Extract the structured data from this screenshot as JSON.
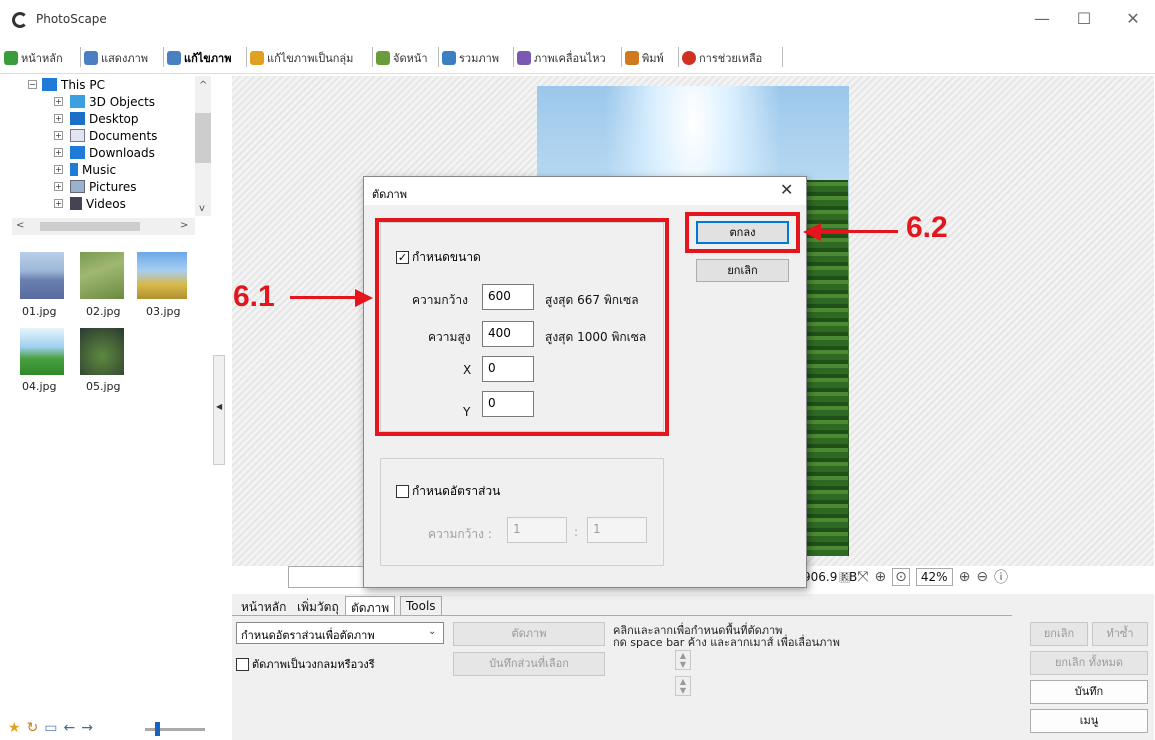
{
  "window": {
    "title": "PhotoScape",
    "minimize": "—",
    "maximize": "☐",
    "close": "✕"
  },
  "modules": [
    {
      "label": "หน้าหลัก",
      "color": "#3a9c3a"
    },
    {
      "label": "แสดงภาพ",
      "color": "#4a7fc1"
    },
    {
      "label": "แก้ไขภาพ",
      "color": "#4a7fc1"
    },
    {
      "label": "แก้ไขภาพเป็นกลุ่ม",
      "color": "#e0a020"
    },
    {
      "label": "จัดหน้า",
      "color": "#6a9c3a"
    },
    {
      "label": "รวมภาพ",
      "color": "#3a7fc1"
    },
    {
      "label": "ภาพเคลื่อนไหว",
      "color": "#7a5ab0"
    },
    {
      "label": "พิมพ์",
      "color": "#d07a20"
    },
    {
      "label": "การช่วยเหลือ",
      "color": "#d03020"
    }
  ],
  "folder_tree": [
    {
      "label": "This PC"
    },
    {
      "label": "3D Objects"
    },
    {
      "label": "Desktop"
    },
    {
      "label": "Documents"
    },
    {
      "label": "Downloads"
    },
    {
      "label": "Music"
    },
    {
      "label": "Pictures"
    },
    {
      "label": "Videos"
    }
  ],
  "thumbnails": [
    {
      "label": "01.jpg"
    },
    {
      "label": "02.jpg"
    },
    {
      "label": "03.jpg"
    },
    {
      "label": "04.jpg"
    },
    {
      "label": "05.jpg"
    }
  ],
  "status": {
    "file_size": "906.9 KB",
    "zoom": "42%"
  },
  "bottom_tabs": {
    "home": "หน้าหลัก",
    "objects": "เพิ่มวัตถุ",
    "crop": "ตัดภาพ",
    "tools": "Tools"
  },
  "crop_panel": {
    "select_value": "กำหนดอัตราส่วนเพื่อตัดภาพ",
    "crop_button": "ตัดภาพ",
    "save_selected_button": "บันทึกส่วนที่เลือก",
    "circle_checkbox_label": "ตัดภาพเป็นวงกลมหรือวงรี",
    "hint_line1": "คลิกและลากเพื่อกำหนดพื้นที่ตัดภาพ",
    "hint_line2": "กด space bar ค้าง และลากเมาส์ เพื่อเลื่อนภาพ"
  },
  "right_buttons": {
    "undo": "ยกเลิก",
    "redo": "ทำซ้ำ",
    "undo_all": "ยกเลิก ทั้งหมด",
    "save": "บันทึก",
    "menu": "เมนู"
  },
  "dialog": {
    "title": "ตัดภาพ",
    "close": "✕",
    "size_checkbox_label": "กำหนดขนาด",
    "width_label": "ความกว้าง",
    "width_value": "600",
    "width_max": "สูงสุด 667 พิกเซล",
    "height_label": "ความสูง",
    "height_value": "400",
    "height_max": "สูงสุด 1000 พิกเซล",
    "x_label": "X",
    "x_value": "0",
    "y_label": "Y",
    "y_value": "0",
    "ratio_checkbox_label": "กำหนดอัตราส่วน",
    "ratio_width_label": "ความกว้าง :",
    "ratio_w_value": "1",
    "ratio_sep": ":",
    "ratio_h_value": "1",
    "ok_button": "ตกลง",
    "cancel_button": "ยกเลิก"
  },
  "annotations": {
    "label_1": "6.1",
    "label_2": "6.2",
    "color": "#e4151c"
  }
}
